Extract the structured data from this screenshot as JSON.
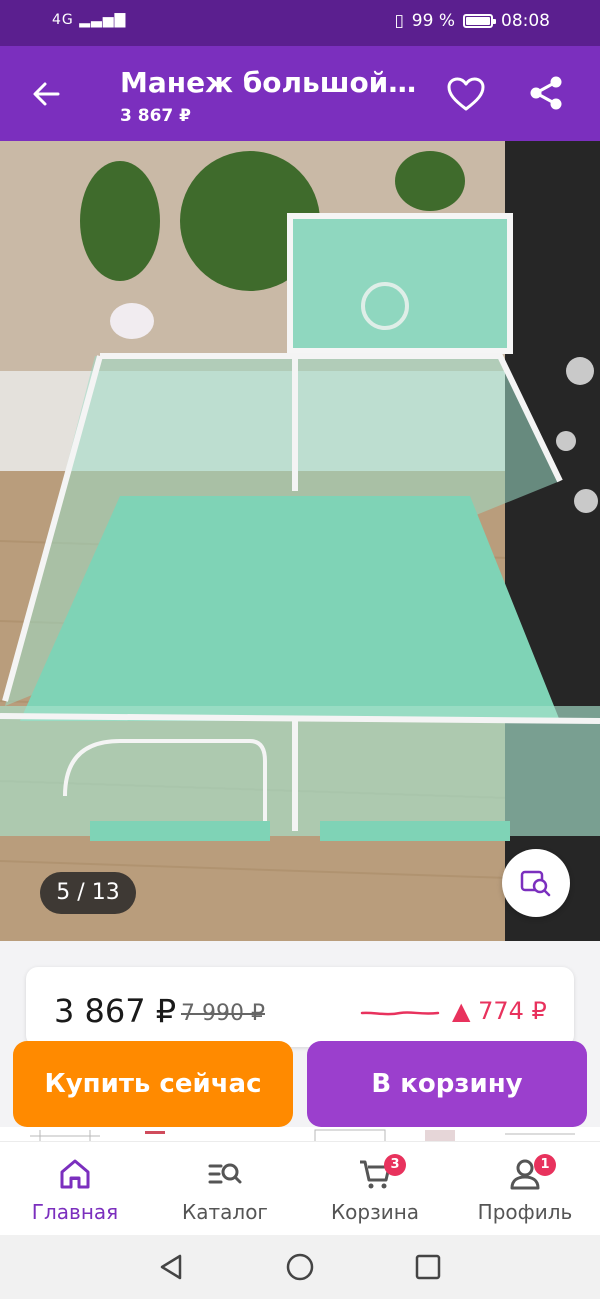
{
  "status_bar": {
    "network": "4G",
    "battery": "99 %",
    "time": "08:08"
  },
  "header": {
    "title": "Манеж большой…",
    "price": "3 867 ₽"
  },
  "gallery": {
    "counter": "5 / 13"
  },
  "price_card": {
    "current_price": "3 867 ₽",
    "old_price": "7 990 ₽",
    "price_change": "▲ 774 ₽"
  },
  "actions": {
    "buy_now": "Купить сейчас",
    "add_to_cart": "В корзину"
  },
  "bottom_nav": {
    "items": [
      {
        "label": "Главная",
        "icon": "home-icon",
        "badge": ""
      },
      {
        "label": "Каталог",
        "icon": "catalog-search-icon",
        "badge": ""
      },
      {
        "label": "Корзина",
        "icon": "cart-icon",
        "badge": "3"
      },
      {
        "label": "Профиль",
        "icon": "profile-icon",
        "badge": "1"
      }
    ]
  },
  "colors": {
    "header": "#7b2fbe",
    "status_bar": "#5b1f8f",
    "accent_orange": "#ff8a00",
    "accent_purple": "#9b3fcd",
    "price_up": "#e8325d"
  }
}
